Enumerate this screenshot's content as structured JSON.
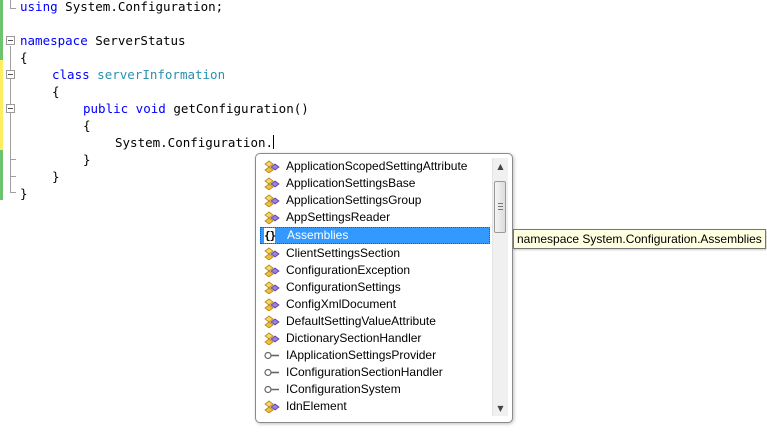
{
  "editor": {
    "lines": [
      {
        "kw": "using",
        "text": " System.Configuration;"
      },
      {
        "kw": "namespace",
        "text": " ServerStatus"
      },
      {
        "text": "{"
      },
      {
        "kw": "class",
        "type": "serverInformation"
      },
      {
        "text": "{"
      },
      {
        "kw": "public void",
        "text": " getConfiguration()"
      },
      {
        "text": "{"
      },
      {
        "text": "System.Configuration."
      },
      {
        "text": "}"
      },
      {
        "text": "}"
      },
      {
        "text": "}"
      }
    ]
  },
  "completion": {
    "items": [
      {
        "label": "ApplicationScopedSettingAttribute",
        "icon": "class-icon"
      },
      {
        "label": "ApplicationSettingsBase",
        "icon": "class-icon"
      },
      {
        "label": "ApplicationSettingsGroup",
        "icon": "class-icon"
      },
      {
        "label": "AppSettingsReader",
        "icon": "class-icon"
      },
      {
        "label": "Assemblies",
        "icon": "namespace-icon",
        "selected": true
      },
      {
        "label": "ClientSettingsSection",
        "icon": "class-icon"
      },
      {
        "label": "ConfigurationException",
        "icon": "class-icon"
      },
      {
        "label": "ConfigurationSettings",
        "icon": "class-icon"
      },
      {
        "label": "ConfigXmlDocument",
        "icon": "class-icon"
      },
      {
        "label": "DefaultSettingValueAttribute",
        "icon": "class-icon"
      },
      {
        "label": "DictionarySectionHandler",
        "icon": "class-icon"
      },
      {
        "label": "IApplicationSettingsProvider",
        "icon": "interface-icon"
      },
      {
        "label": "IConfigurationSectionHandler",
        "icon": "interface-icon"
      },
      {
        "label": "IConfigurationSystem",
        "icon": "interface-icon"
      },
      {
        "label": "IdnElement",
        "icon": "class-icon"
      }
    ],
    "namespace_glyph": "{}"
  },
  "tooltip": {
    "text": "namespace System.Configuration.Assemblies"
  },
  "colors": {
    "keyword": "#0000ff",
    "type": "#2b91af",
    "selection": "#3399ff",
    "tooltip_bg": "#ffffe1",
    "changed_marker": "#ffee62",
    "saved_marker": "#6ec36e"
  }
}
